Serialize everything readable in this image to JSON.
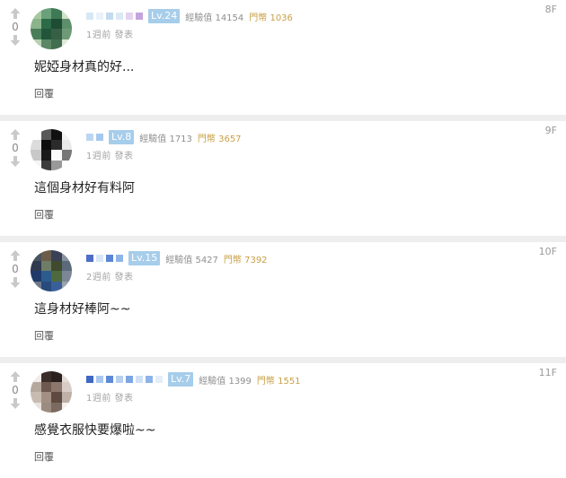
{
  "posts": [
    {
      "floor": "8F",
      "votes": "0",
      "level": "Lv.24",
      "exp": "經驗值 14154",
      "coins": "門幣 1036",
      "posted": "1週前 發表",
      "content": "妮婭身材真的好...",
      "reply": "回覆",
      "avatar_colors": [
        "#a8c8a0",
        "#6aa07a",
        "#3f7a56",
        "#cfe1c8",
        "#8bb48c",
        "#2d6a48",
        "#1d4d34",
        "#5d8f6a",
        "#4a7d59",
        "#22563b",
        "#375f45",
        "#6f9a78",
        "#b7d1b0",
        "#5a8765",
        "#416e50",
        "#dfe9d9"
      ],
      "name_colors": [
        "#d6e7f7",
        "#e9f1f9",
        "#c3dbf1",
        "#dce9f5",
        "#e4d2ef",
        "#c5a4dc"
      ]
    },
    {
      "floor": "9F",
      "votes": "0",
      "level": "Lv.8",
      "exp": "經驗值 1713",
      "coins": "門幣 3657",
      "posted": "1週前 發表",
      "content": "這個身材好有料阿",
      "reply": "回覆",
      "avatar_colors": [
        "#ffffff",
        "#5a5a5a",
        "#111111",
        "#f3f3f3",
        "#dcdcdc",
        "#0e0e0e",
        "#2b2b2b",
        "#e9e9e9",
        "#c8c8c8",
        "#1a1a1a",
        "#fafafa",
        "#777777",
        "#f5f5f5",
        "#3c3c3c",
        "#999999",
        "#ffffff"
      ],
      "name_colors": [
        "#bcd6f1",
        "#a7c8ee"
      ]
    },
    {
      "floor": "10F",
      "votes": "0",
      "level": "Lv.15",
      "exp": "經驗值 5427",
      "coins": "門幣 7392",
      "posted": "2週前 發表",
      "content": "這身材好棒阿~~",
      "reply": "回覆",
      "avatar_colors": [
        "#4a5360",
        "#6b5d4a",
        "#3a4156",
        "#88929f",
        "#2f3a4f",
        "#6f7d66",
        "#3f4a2f",
        "#5a6a7a",
        "#1f3a6a",
        "#2c5c8e",
        "#4e6a3c",
        "#7b8796",
        "#6f7888",
        "#284a7c",
        "#3a5f98",
        "#9aa3ad"
      ],
      "name_colors": [
        "#4e6ec7",
        "#d9e6f5",
        "#5b86d6",
        "#8fb5e8"
      ]
    },
    {
      "floor": "11F",
      "votes": "0",
      "level": "Lv.7",
      "exp": "經驗值 1399",
      "coins": "門幣 1551",
      "posted": "1週前 發表",
      "content": "感覺衣服快要爆啦~~",
      "reply": "回覆",
      "avatar_colors": [
        "#f1ece8",
        "#3b2d28",
        "#2a211e",
        "#e3dcd6",
        "#b7a89e",
        "#6e5950",
        "#8d766b",
        "#d7cdc6",
        "#c8bcb2",
        "#a38f83",
        "#5e4a41",
        "#bfb1a7",
        "#e8e2dd",
        "#9b8b80",
        "#7b6a60",
        "#f4f0ed"
      ],
      "name_colors": [
        "#3e68c4",
        "#a9c7ee",
        "#5d8ad8",
        "#b7d0ef",
        "#7ca6e4",
        "#d0e1f5",
        "#8db3e8",
        "#e4eef9"
      ]
    }
  ]
}
